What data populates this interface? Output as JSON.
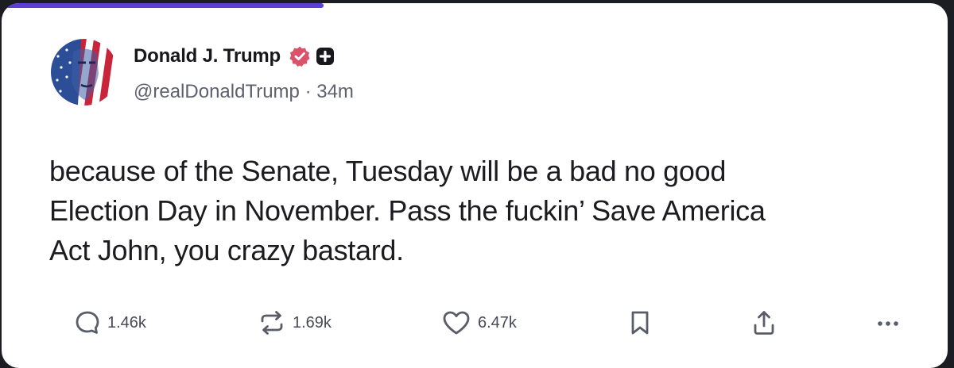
{
  "post": {
    "author": {
      "display_name": "Donald J. Trump",
      "handle": "@realDonaldTrump",
      "time_ago": "34m",
      "separator": "·",
      "verified_icon": "verified-badge-icon",
      "extra_icon": "plus-badge-icon"
    },
    "text_lines": [
      "because of the Senate, Tuesday will be a bad no good",
      "Election Day in November. Pass the fuckin’ Save America",
      "Act John, you crazy bastard."
    ],
    "actions": {
      "replies": {
        "icon": "reply-icon",
        "count": "1.46k"
      },
      "retruths": {
        "icon": "retruth-icon",
        "count": "1.69k"
      },
      "likes": {
        "icon": "heart-icon",
        "count": "6.47k"
      },
      "bookmark": {
        "icon": "bookmark-icon"
      },
      "share": {
        "icon": "share-icon"
      },
      "more": {
        "icon": "more-icon"
      }
    }
  },
  "load_progress": 0.34,
  "colors": {
    "progress_bar": "#5b3fd6",
    "verified_badge": "#d9536b",
    "text": "#1b1b20",
    "muted": "#5e6070"
  }
}
